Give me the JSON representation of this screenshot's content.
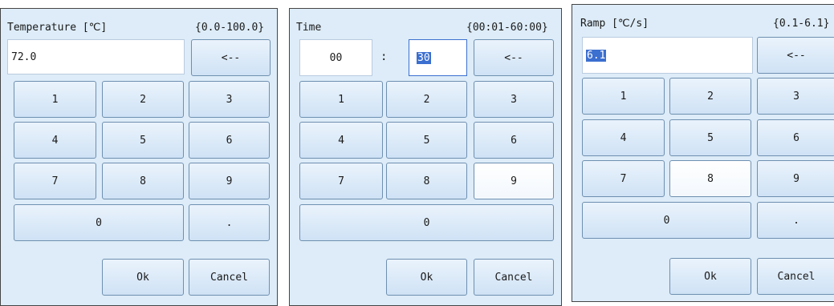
{
  "temperature": {
    "title": "Temperature [℃]",
    "range": "{0.0-100.0}",
    "value": "72.0"
  },
  "time": {
    "title": "Time",
    "range": "{00:01-60:00}",
    "minutes": "00",
    "separator": ":",
    "seconds": "30"
  },
  "ramp": {
    "title": "Ramp [℃/s]",
    "range": "{0.1-6.1}",
    "value": "6.1"
  },
  "keys": {
    "backspace": "<--",
    "k1": "1",
    "k2": "2",
    "k3": "3",
    "k4": "4",
    "k5": "5",
    "k6": "6",
    "k7": "7",
    "k8": "8",
    "k9": "9",
    "k0": "0",
    "dot": ".",
    "ok": "Ok",
    "cancel": "Cancel"
  }
}
